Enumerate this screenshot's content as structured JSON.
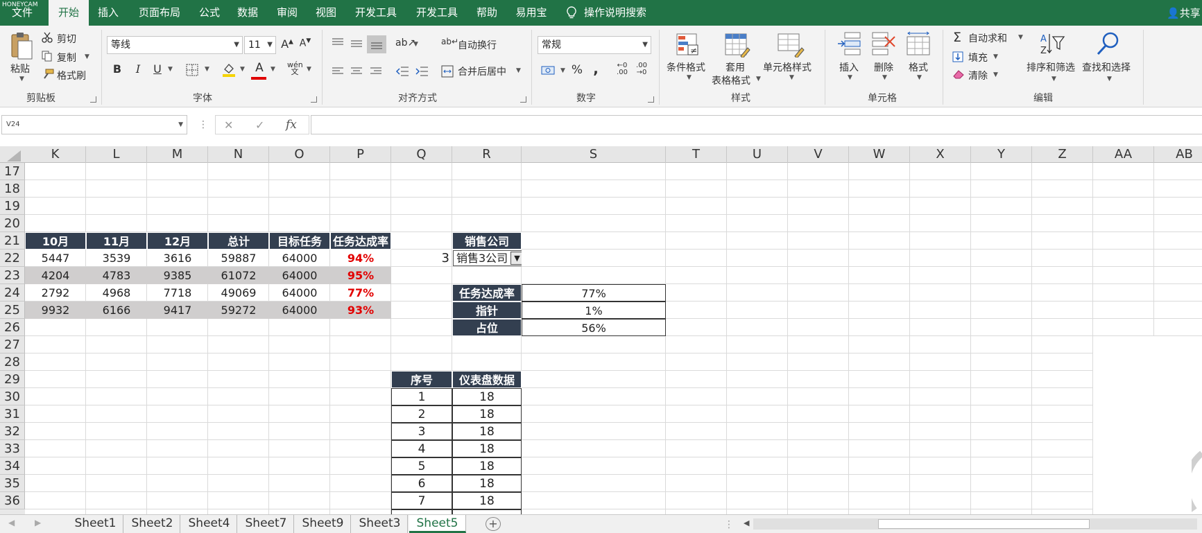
{
  "app": {
    "watermark": "HONEYCAM"
  },
  "menu": {
    "tabs": [
      {
        "label": "文件"
      },
      {
        "label": "开始"
      },
      {
        "label": "插入"
      },
      {
        "label": "页面布局"
      },
      {
        "label": "公式"
      },
      {
        "label": "数据"
      },
      {
        "label": "审阅"
      },
      {
        "label": "视图"
      },
      {
        "label": "开发工具"
      },
      {
        "label": "开发工具"
      },
      {
        "label": "帮助"
      },
      {
        "label": "易用宝"
      }
    ],
    "active_tab": "开始",
    "search": "操作说明搜索",
    "share": "共享"
  },
  "ribbon": {
    "clipboard": {
      "paste": "粘贴",
      "cut": "剪切",
      "copy": "复制",
      "format_painter": "格式刷",
      "group": "剪贴板"
    },
    "font": {
      "name": "等线",
      "size": "11",
      "bold": "B",
      "italic": "I",
      "underline": "U",
      "group": "字体"
    },
    "alignment": {
      "wrap": "自动换行",
      "merge": "合并后居中",
      "group": "对齐方式"
    },
    "number": {
      "format": "常规",
      "percent": "%",
      "comma": ",",
      "inc_decimal": ".00",
      "dec_decimal": ".00",
      "group": "数字"
    },
    "styles": {
      "conditional": "条件格式",
      "table_1": "套用",
      "table_2": "表格格式",
      "cell_styles": "单元格样式",
      "group": "样式"
    },
    "cells": {
      "insert": "插入",
      "delete": "删除",
      "format": "格式",
      "group": "单元格"
    },
    "editing": {
      "autosum": "自动求和",
      "fill": "填充",
      "clear": "清除",
      "sort": "排序和筛选",
      "find": "查找和选择",
      "group": "编辑"
    }
  },
  "formula_bar": {
    "name_box": "V24",
    "cancel": "✕",
    "enter": "✓",
    "fx": "fx",
    "formula": ""
  },
  "sheet": {
    "columns": [
      "K",
      "L",
      "M",
      "N",
      "O",
      "P",
      "Q",
      "R",
      "S",
      "T",
      "U",
      "V",
      "W",
      "X",
      "Y",
      "Z",
      "AA",
      "AB"
    ],
    "rows": [
      "17",
      "18",
      "19",
      "20",
      "21",
      "22",
      "23",
      "24",
      "25",
      "26",
      "27",
      "28",
      "29",
      "30",
      "31",
      "32",
      "33",
      "34",
      "35",
      "36"
    ],
    "table1": {
      "headers": [
        "10月",
        "11月",
        "12月",
        "总计",
        "目标任务",
        "任务达成率"
      ],
      "rows": [
        [
          "5447",
          "3539",
          "3616",
          "59887",
          "64000",
          "94%"
        ],
        [
          "4204",
          "4783",
          "9385",
          "61072",
          "64000",
          "95%"
        ],
        [
          "2792",
          "4968",
          "7718",
          "49069",
          "64000",
          "77%"
        ],
        [
          "9932",
          "6166",
          "9417",
          "59272",
          "64000",
          "93%"
        ]
      ]
    },
    "q22": "3",
    "company": {
      "header": "销售公司",
      "value": "销售3公司"
    },
    "summary": [
      {
        "label": "任务达成率",
        "value": "77%"
      },
      {
        "label": "指针",
        "value": "1%"
      },
      {
        "label": "占位",
        "value": "56%"
      }
    ],
    "dial": {
      "headers": [
        "序号",
        "仪表盘数据"
      ],
      "rows": [
        [
          "1",
          "18"
        ],
        [
          "2",
          "18"
        ],
        [
          "3",
          "18"
        ],
        [
          "4",
          "18"
        ],
        [
          "5",
          "18"
        ],
        [
          "6",
          "18"
        ],
        [
          "7",
          "18"
        ]
      ]
    }
  },
  "sheet_tabs": {
    "tabs": [
      "Sheet1",
      "Sheet2",
      "Sheet4",
      "Sheet7",
      "Sheet9",
      "Sheet3",
      "Sheet5"
    ],
    "active": "Sheet5"
  }
}
